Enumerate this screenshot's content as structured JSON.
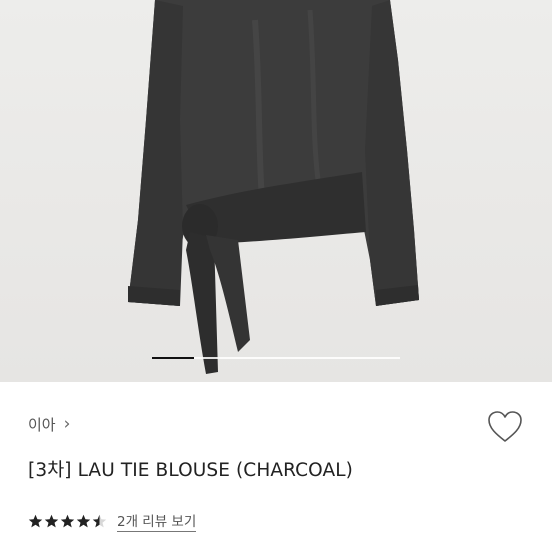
{
  "product": {
    "shop_name": "이아",
    "title": "[3차] LAU TIE BLOUSE (CHARCOAL)",
    "rating": 4.5,
    "review_link": "2개 리뷰 보기",
    "image_carousel_progress": 0.17
  },
  "icons": {
    "shop_chevron": "›",
    "wishlist": "heart-outline-icon",
    "star": "star-icon"
  },
  "colors": {
    "garment": "#3a3a3a",
    "star": "#222222",
    "progress": "#111111"
  }
}
